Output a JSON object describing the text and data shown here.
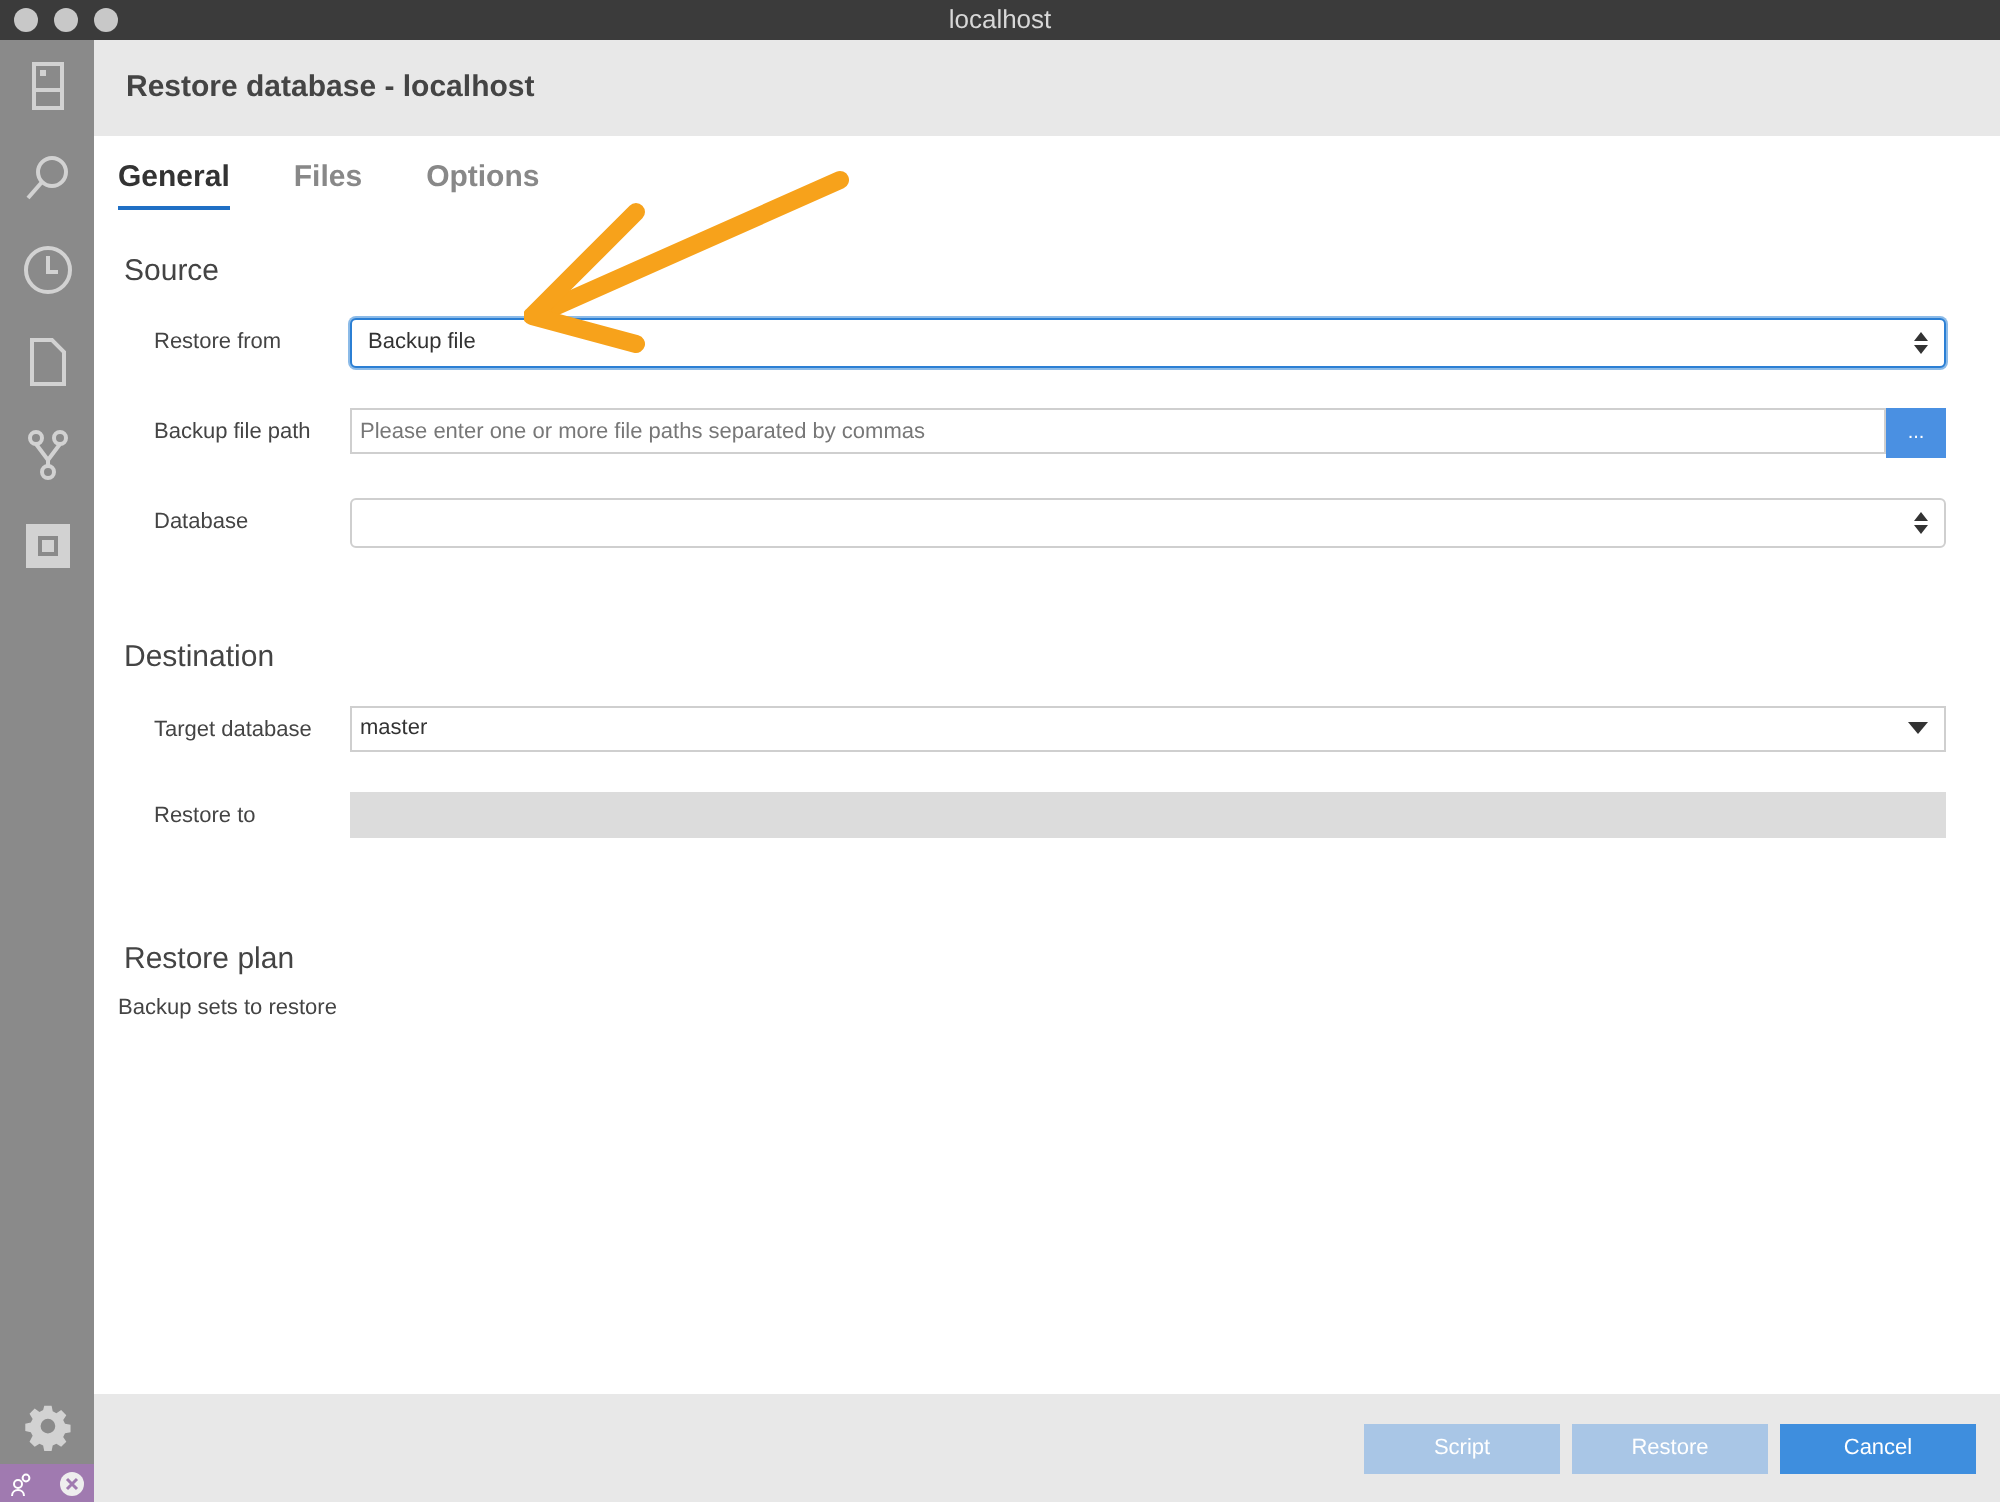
{
  "window": {
    "title": "localhost"
  },
  "dialog": {
    "title": "Restore database - localhost"
  },
  "tabs": [
    {
      "label": "General",
      "selected": true
    },
    {
      "label": "Files",
      "selected": false
    },
    {
      "label": "Options",
      "selected": false
    }
  ],
  "sections": [
    {
      "title": "Source",
      "fields": [
        {
          "label": "Restore from",
          "kind": "select",
          "value": "Backup file",
          "focused": true
        },
        {
          "label": "Backup file path",
          "kind": "path",
          "placeholder": "Please enter one or more file paths separated by commas",
          "button": "..."
        },
        {
          "label": "Database",
          "kind": "select",
          "focused": false
        }
      ]
    },
    {
      "title": "Destination",
      "fields": [
        {
          "label": "Target database",
          "kind": "dropdown",
          "value": "master"
        },
        {
          "label": "Restore to",
          "kind": "disabled"
        }
      ]
    },
    {
      "title": "Restore plan",
      "subtitle": "Backup sets to restore"
    }
  ],
  "buttons": [
    {
      "label": "Script",
      "disabled": true
    },
    {
      "label": "Restore",
      "disabled": true
    },
    {
      "label": "Cancel",
      "disabled": false
    }
  ]
}
